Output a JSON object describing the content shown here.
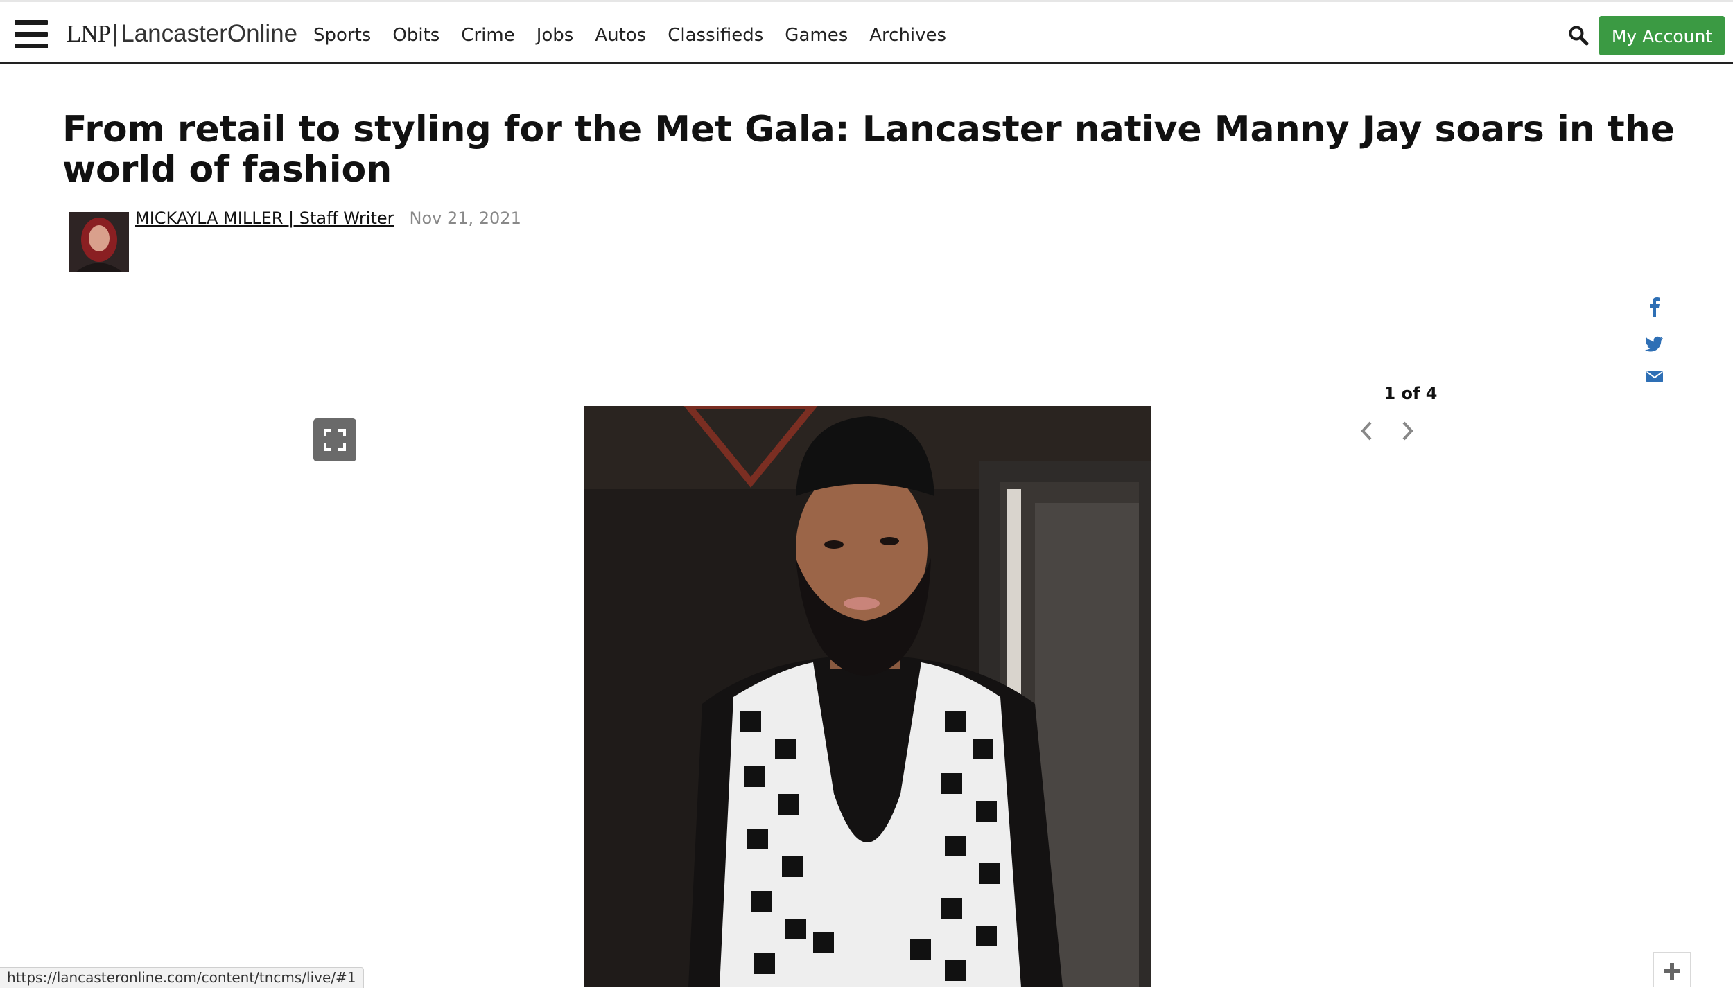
{
  "header": {
    "logo": {
      "mark": "LNP",
      "name": "LancasterOnline"
    },
    "nav": [
      "Sports",
      "Obits",
      "Crime",
      "Jobs",
      "Autos",
      "Classifieds",
      "Games",
      "Archives"
    ],
    "account_label": "My Account",
    "account_color": "#3b9a43"
  },
  "article": {
    "headline": "From retail to styling for the Met Gala: Lancaster native Manny Jay soars in the world of fashion",
    "author": "MICKAYLA MILLER | Staff Writer",
    "date": "Nov 21, 2021"
  },
  "share": {
    "icons": [
      "facebook-icon",
      "twitter-icon",
      "email-icon"
    ],
    "color": "#2e6fb5"
  },
  "gallery": {
    "counter": "1 of 4"
  },
  "status_bar": {
    "url": "https://lancasteronline.com/content/tncms/live/#1"
  }
}
